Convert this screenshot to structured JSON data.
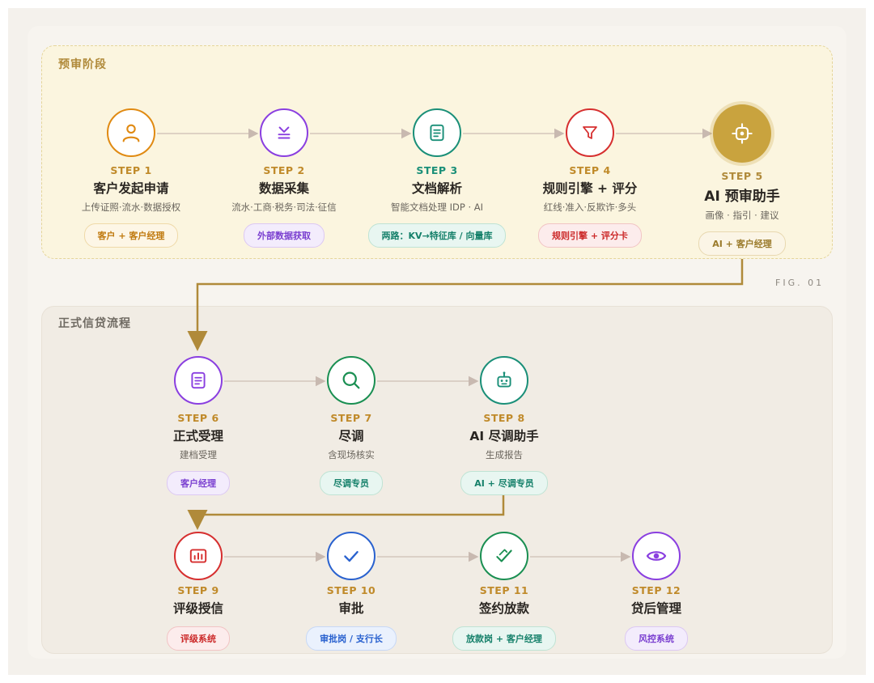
{
  "stages": {
    "pre": {
      "title": "预审阶段"
    },
    "formal": {
      "title": "正式信贷流程"
    }
  },
  "fig_label": "FIG. 01",
  "steps": [
    {
      "no": "STEP 1",
      "title": "客户发起申请",
      "desc": "上传证照·流水·数据授权",
      "tag": "客户 + 客户经理",
      "icon": "user-icon",
      "color": "#e08a12"
    },
    {
      "no": "STEP 2",
      "title": "数据采集",
      "desc": "流水·工商·税务·司法·征信",
      "tag": "外部数据获取",
      "icon": "download-icon",
      "color": "#8a3fe0"
    },
    {
      "no": "STEP 3",
      "title": "文档解析",
      "desc": "智能文档处理 IDP · AI",
      "tag": "两路：KV→特征库 / 向量库",
      "icon": "document-icon",
      "color": "#1a8f78"
    },
    {
      "no": "STEP 4",
      "title": "规则引擎 + 评分",
      "desc": "红线·准入·反欺诈·多头",
      "tag": "规则引擎 + 评分卡",
      "icon": "funnel-icon",
      "color": "#d62f2f"
    },
    {
      "no": "STEP 5",
      "title": "AI 预审助手",
      "desc": "画像 · 指引 · 建议",
      "tag": "AI + 客户经理",
      "icon": "target-icon",
      "color": "#b08a3a"
    },
    {
      "no": "STEP 6",
      "title": "正式受理",
      "desc": "建档受理",
      "tag": "客户经理",
      "icon": "document-icon",
      "color": "#8a3fe0"
    },
    {
      "no": "STEP 7",
      "title": "尽调",
      "desc": "含现场核实",
      "tag": "尽调专员",
      "icon": "search-icon",
      "color": "#1a8f52"
    },
    {
      "no": "STEP 8",
      "title": "AI 尽调助手",
      "desc": "生成报告",
      "tag": "AI + 尽调专员",
      "icon": "robot-icon",
      "color": "#1a8f78"
    },
    {
      "no": "STEP 9",
      "title": "评级授信",
      "desc": "",
      "tag": "评级系统",
      "icon": "bar-chart-icon",
      "color": "#d62f2f"
    },
    {
      "no": "STEP 10",
      "title": "审批",
      "desc": "",
      "tag": "审批岗 / 支行长",
      "icon": "check-icon",
      "color": "#2a62cf"
    },
    {
      "no": "STEP 11",
      "title": "签约放款",
      "desc": "",
      "tag": "放款岗 + 客户经理",
      "icon": "sign-icon",
      "color": "#1a8f52"
    },
    {
      "no": "STEP 12",
      "title": "贷后管理",
      "desc": "",
      "tag": "风控系统",
      "icon": "eye-icon",
      "color": "#8a3fe0"
    }
  ]
}
